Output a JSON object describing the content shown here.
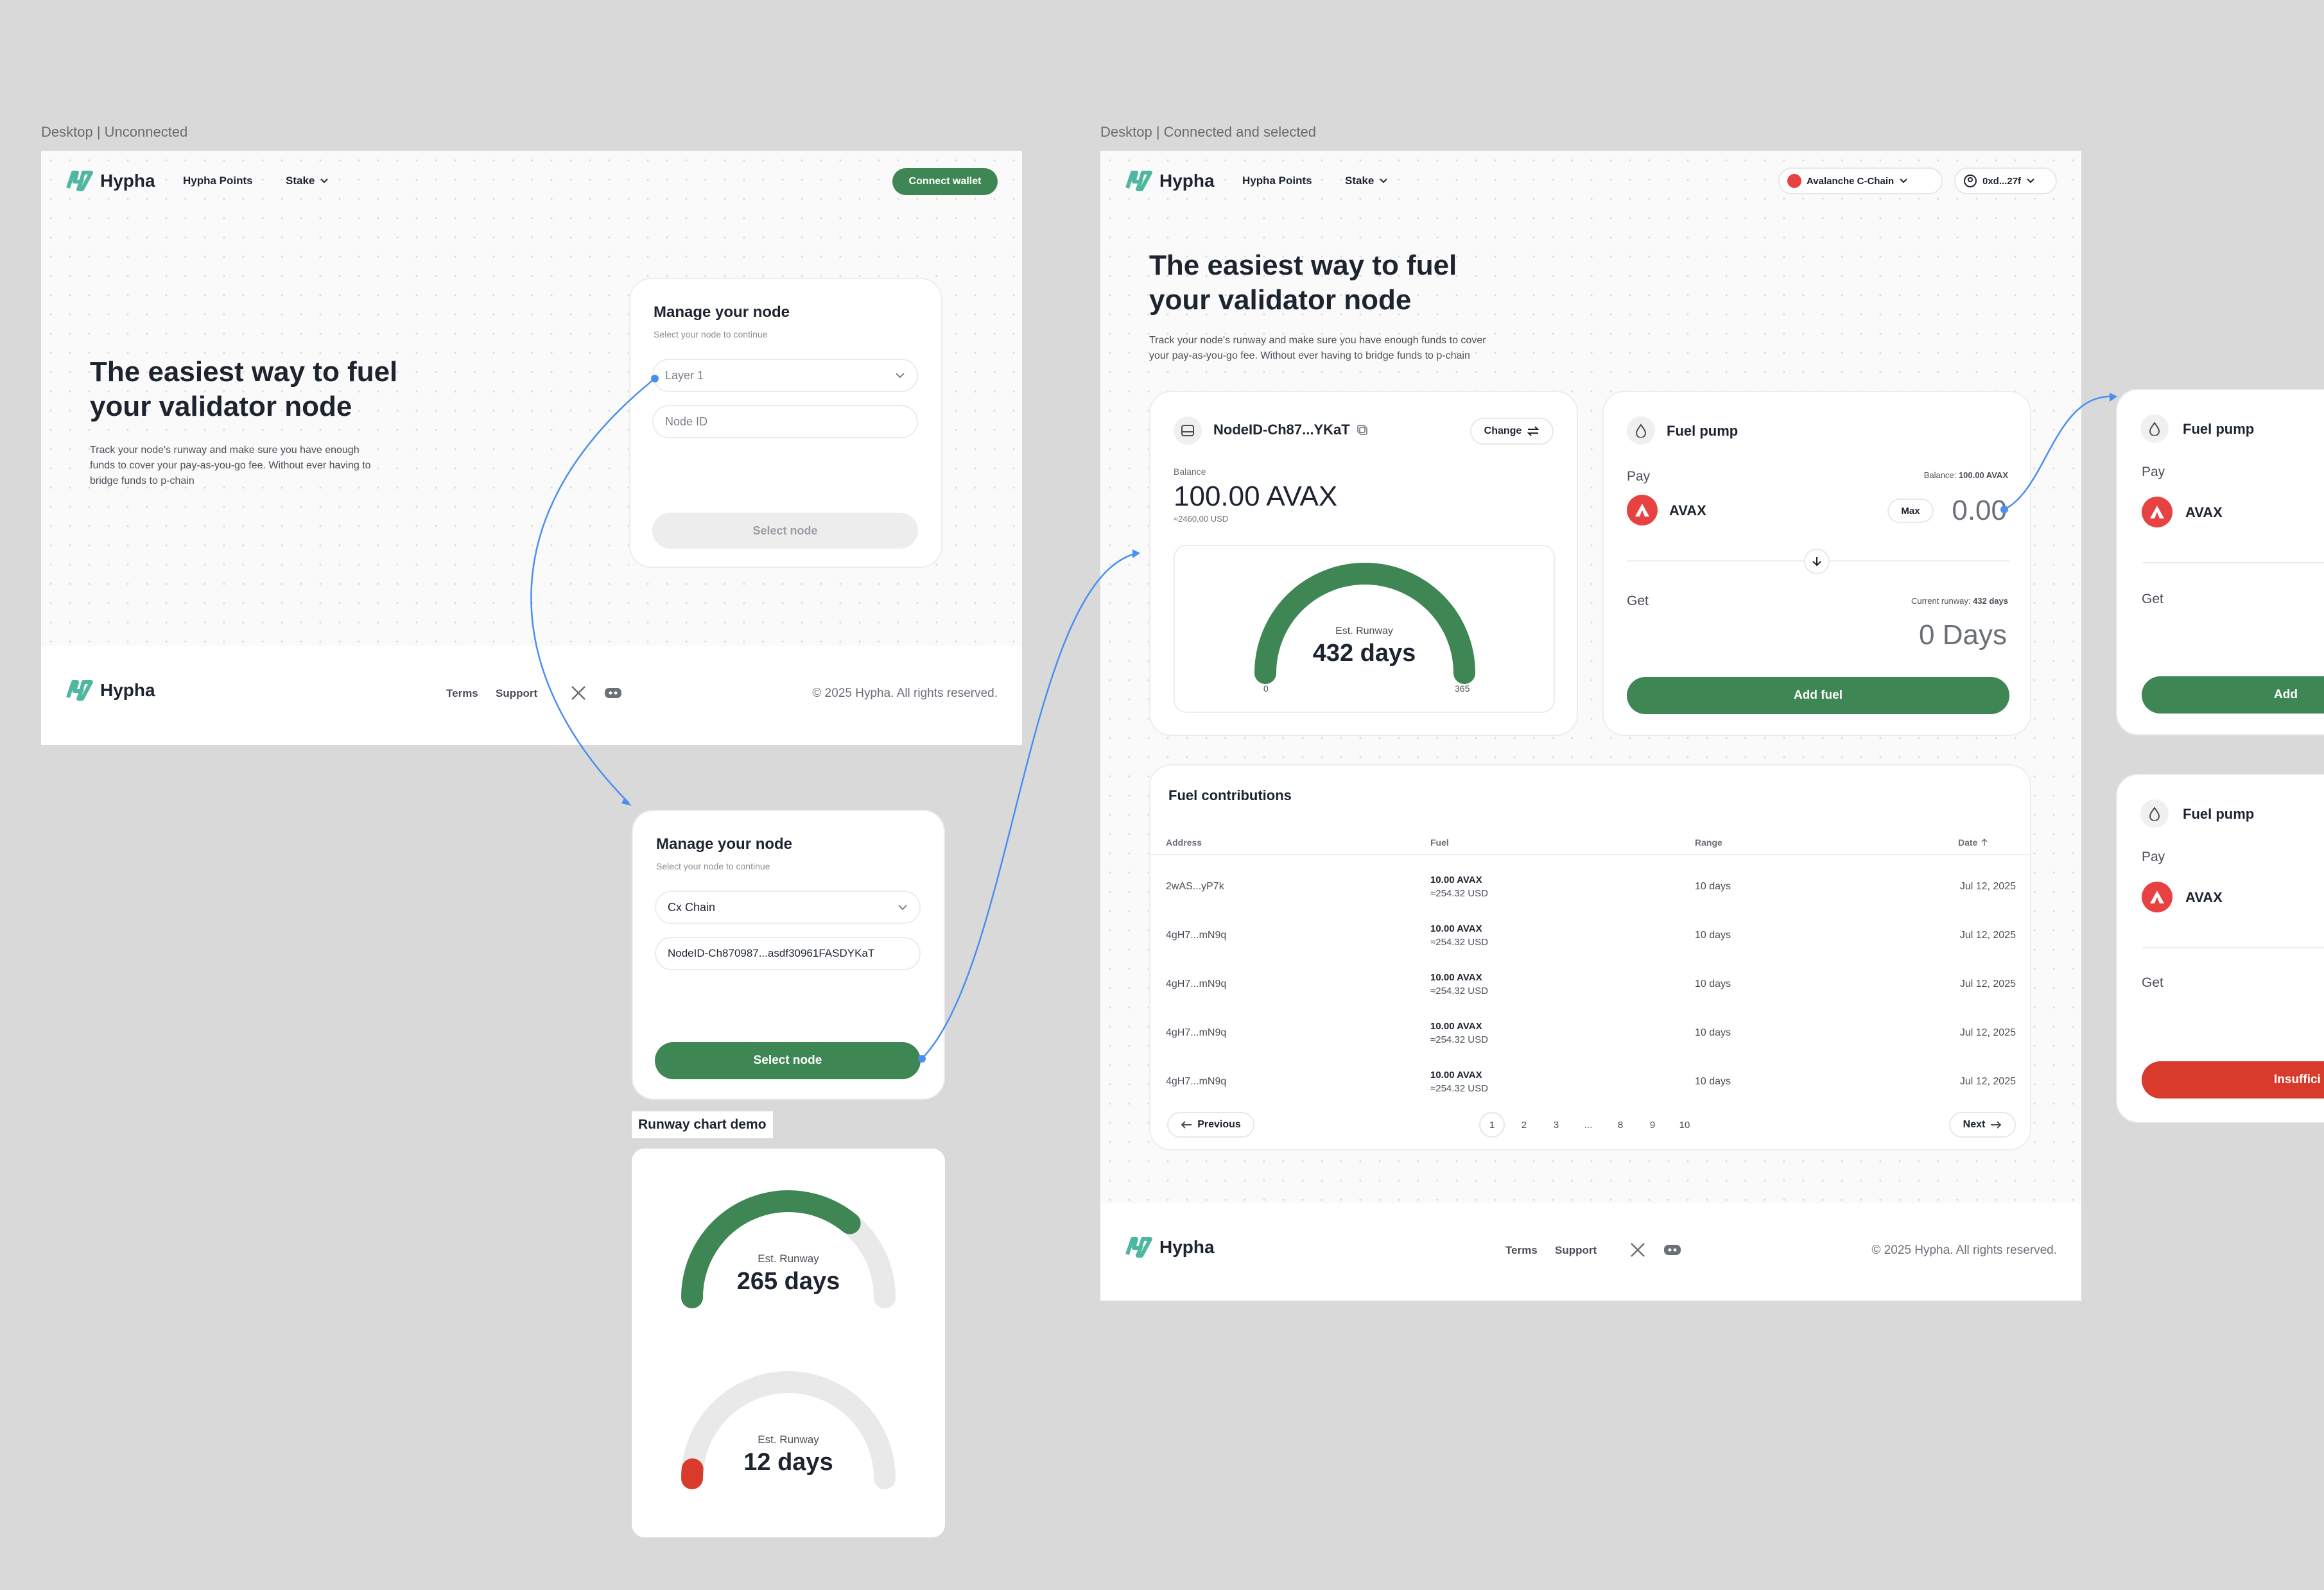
{
  "labels": {
    "unconnected": "Desktop | Unconnected",
    "connected": "Desktop | Connected and selected",
    "runway_demo": "Runway chart demo"
  },
  "brand": {
    "name": "Hypha",
    "accent": "#3e8653",
    "danger": "#d83a2b",
    "link_line": "#4a8ef0"
  },
  "nav": {
    "points": "Hypha Points",
    "stake": "Stake",
    "connect": "Connect wallet",
    "chain": "Avalanche C-Chain",
    "account": "0xd...27f"
  },
  "hero": {
    "title_line1": "The easiest way to fuel",
    "title_line2": "your validator node",
    "text_line1": "Track your node's runway and make sure you have enough",
    "text_line2": "funds to cover your pay-as-you-go fee. Without ever having to",
    "text_line3": "bridge funds to p-chain",
    "text2_line1": "Track your node's runway and make sure you have enough funds to cover",
    "text2_line2": "your pay-as-you-go fee. Without ever having to bridge funds to p-chain"
  },
  "manage": {
    "title": "Manage your node",
    "subtitle": "Select your node to continue",
    "layer_placeholder": "Layer 1",
    "node_placeholder": "Node ID",
    "select": "Select node",
    "chain_value": "Cx Chain",
    "node_value": "NodeID-Ch870987...asdf30961FASDYKaT"
  },
  "footer": {
    "terms": "Terms",
    "support": "Support",
    "copyright": "© 2025 Hypha. All rights reserved."
  },
  "node": {
    "id": "NodeID-Ch87...YKaT",
    "change": "Change",
    "balance_label": "Balance",
    "balance": "100.00 AVAX",
    "balance_usd": "≈2460,00 USD",
    "runway_label": "Est. Runway",
    "runway": "432 days",
    "runway_fraction": 1.0,
    "min": "0",
    "max": "365"
  },
  "pump": {
    "title": "Fuel pump",
    "pay": "Pay",
    "balance": "Balance:",
    "balance_value": "100.00 AVAX",
    "token": "AVAX",
    "max": "Max",
    "amount": "0.00",
    "get": "Get",
    "current_runway": "Current runway:",
    "current_runway_value": "432 days",
    "get_value": "0 Days",
    "add_fuel": "Add fuel",
    "add_fuel_cut": "Add",
    "insufficient": "Insuffici"
  },
  "contributions": {
    "title": "Fuel contributions",
    "headers": {
      "address": "Address",
      "fuel": "Fuel",
      "range": "Range",
      "date": "Date"
    },
    "rows": [
      {
        "address": "2wAS...yP7k",
        "fuel": "10.00 AVAX",
        "usd": "≈254.32 USD",
        "range": "10 days",
        "date": "Jul 12, 2025"
      },
      {
        "address": "4gH7...mN9q",
        "fuel": "10.00 AVAX",
        "usd": "≈254.32 USD",
        "range": "10 days",
        "date": "Jul 12, 2025"
      },
      {
        "address": "4gH7...mN9q",
        "fuel": "10.00 AVAX",
        "usd": "≈254.32 USD",
        "range": "10 days",
        "date": "Jul 12, 2025"
      },
      {
        "address": "4gH7...mN9q",
        "fuel": "10.00 AVAX",
        "usd": "≈254.32 USD",
        "range": "10 days",
        "date": "Jul 12, 2025"
      },
      {
        "address": "4gH7...mN9q",
        "fuel": "10.00 AVAX",
        "usd": "≈254.32 USD",
        "range": "10 days",
        "date": "Jul 12, 2025"
      }
    ],
    "previous": "Previous",
    "next": "Next",
    "pages": [
      "1",
      "2",
      "3",
      "...",
      "8",
      "9",
      "10"
    ]
  },
  "demo": {
    "g1_label": "Est. Runway",
    "g1_value": "265 days",
    "g1_fraction": 0.72,
    "g2_label": "Est. Runway",
    "g2_value": "12 days",
    "g2_fraction": 0.03
  },
  "icons": [
    "chevron-down-icon",
    "copy-icon",
    "swap-icon",
    "fuel-icon",
    "arrow-down-icon",
    "arrow-left-icon",
    "arrow-right-icon",
    "x-logo-icon",
    "discord-icon",
    "server-icon",
    "avax-icon",
    "user-icon",
    "sort-up-icon"
  ]
}
